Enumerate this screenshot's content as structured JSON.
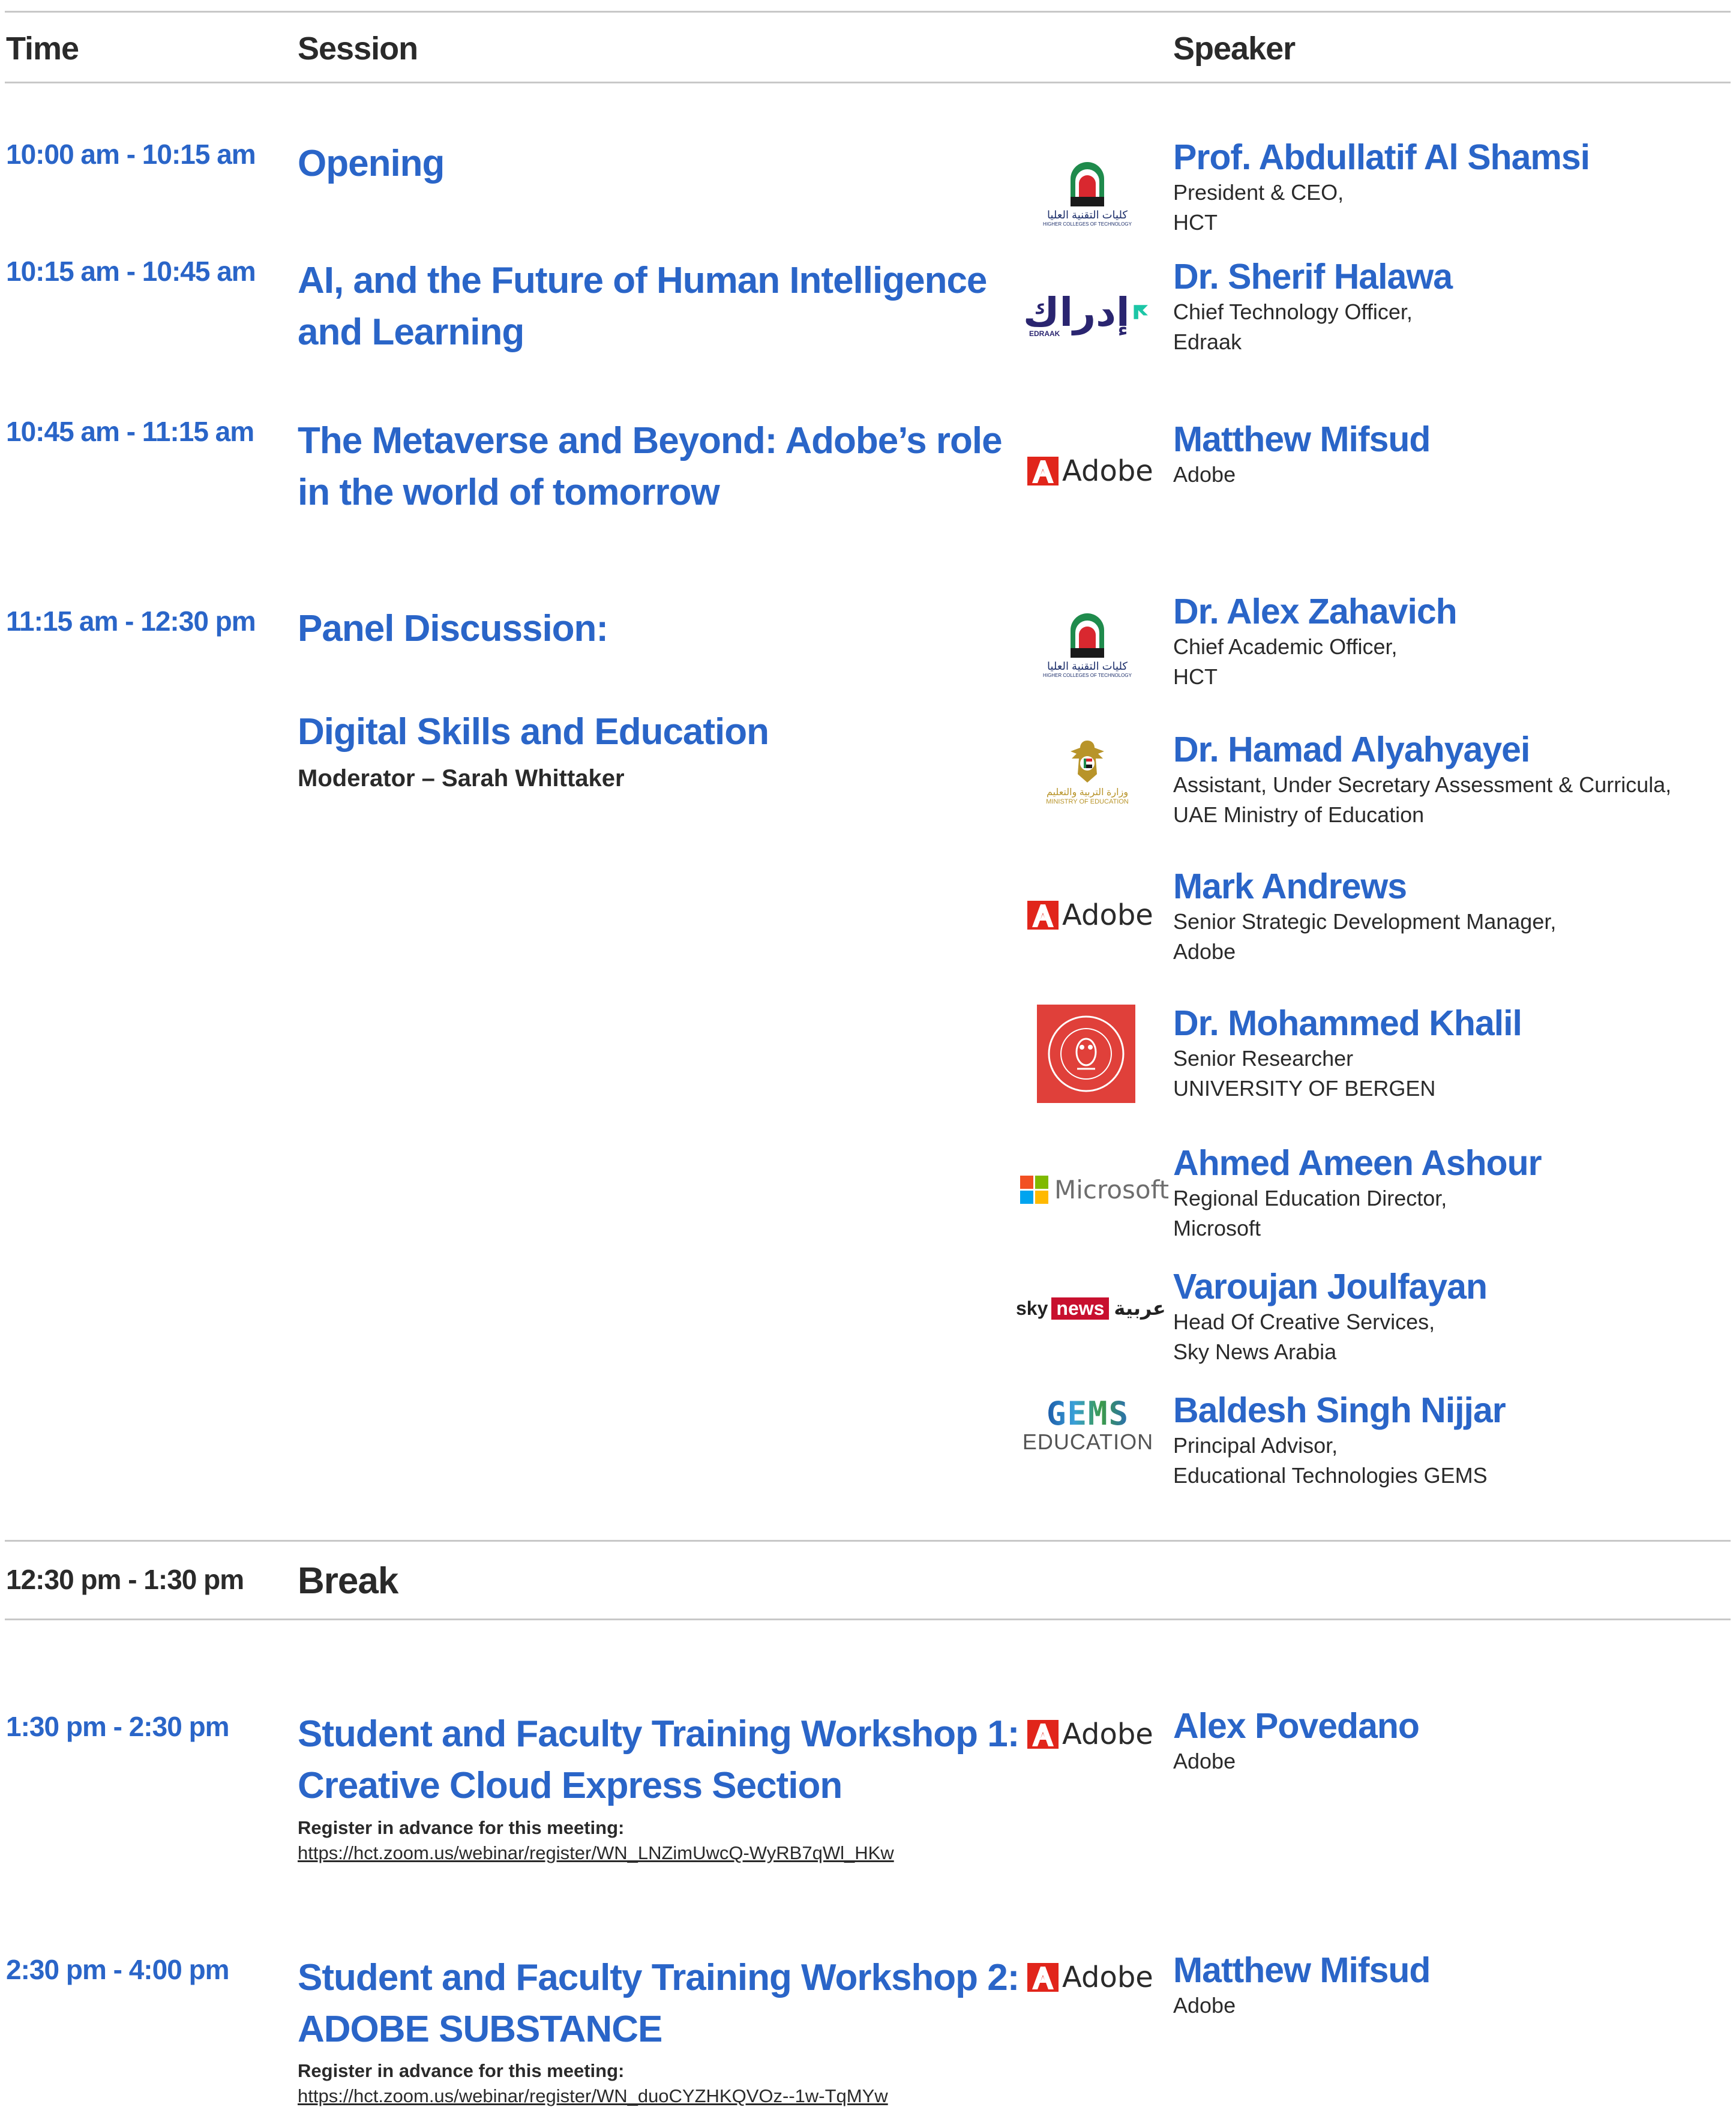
{
  "header": {
    "time": "Time",
    "session": "Session",
    "speaker": "Speaker"
  },
  "rows": [
    {
      "time": "10:00 am - 10:15 am",
      "title": "Opening"
    },
    {
      "time": "10:15 am - 10:45 am",
      "title_lines": [
        "AI, and the Future of Human Intelligence",
        "and Learning"
      ]
    },
    {
      "time": "10:45 am - 11:15 am",
      "title_lines": [
        "The Metaverse and Beyond: Adobe’s role",
        "in the world of tomorrow"
      ]
    },
    {
      "time": "11:15 am - 12:30 pm",
      "title": "Panel Discussion:",
      "subtitle": "Digital Skills and Education",
      "moderator": "Moderator – Sarah Whittaker"
    },
    {
      "time": "12:30 pm - 1:30 pm",
      "title": "Break"
    },
    {
      "time": "1:30 pm - 2:30 pm",
      "title_lines": [
        "Student and Faculty Training Workshop 1:",
        "Creative Cloud Express Section"
      ],
      "register_label": "Register in advance for this meeting:",
      "register_link": "https://hct.zoom.us/webinar/register/WN_LNZimUwcQ-WyRB7qWl_HKw"
    },
    {
      "time": "2:30 pm - 4:00 pm",
      "title_lines": [
        "Student and Faculty Training Workshop 2:",
        "ADOBE SUBSTANCE"
      ],
      "register_label": "Register in advance for this meeting:",
      "register_link": "https://hct.zoom.us/webinar/register/WN_duoCYZHKQVOz--1w-TqMYw"
    }
  ],
  "speakers": [
    {
      "name": "Prof. Abdullatif Al Shamsi",
      "role": [
        "President & CEO,",
        "HCT"
      ],
      "logo": "hct-logo"
    },
    {
      "name": "Dr. Sherif Halawa",
      "role": [
        "Chief Technology Officer,",
        "Edraak"
      ],
      "logo": "edraak-logo"
    },
    {
      "name": "Matthew Mifsud",
      "role": [
        "Adobe"
      ],
      "logo": "adobe-logo"
    },
    {
      "name": "Dr. Alex Zahavich",
      "role": [
        "Chief Academic Officer,",
        "HCT"
      ],
      "logo": "hct-logo"
    },
    {
      "name": "Dr. Hamad Alyahyayei",
      "role": [
        "Assistant, Under Secretary Assessment & Curricula,",
        "UAE Ministry of Education"
      ],
      "logo": "moe-logo"
    },
    {
      "name": "Mark Andrews",
      "role": [
        "Senior Strategic Development Manager,",
        "Adobe"
      ],
      "logo": "adobe-logo"
    },
    {
      "name": "Dr. Mohammed Khalil",
      "role": [
        "Senior Researcher",
        "UNIVERSITY OF BERGEN"
      ],
      "logo": "bergen-logo"
    },
    {
      "name": "Ahmed Ameen Ashour",
      "role": [
        "Regional Education Director,",
        "Microsoft"
      ],
      "logo": "microsoft-logo"
    },
    {
      "name": "Varoujan Joulfayan",
      "role": [
        "Head Of Creative Services,",
        "Sky News Arabia"
      ],
      "logo": "skynews-logo"
    },
    {
      "name": "Baldesh Singh Nijjar",
      "role": [
        "Principal Advisor,",
        "Educational Technologies GEMS"
      ],
      "logo": "gems-logo"
    },
    {
      "name": "Alex Povedano",
      "role": [
        "Adobe"
      ],
      "logo": "adobe-logo"
    },
    {
      "name": "Matthew Mifsud",
      "role": [
        "Adobe"
      ],
      "logo": "adobe-logo"
    }
  ],
  "logos": {
    "hct": {
      "text_ar": "كليات التقنية العليا",
      "text_en": "HIGHER COLLEGES OF TECHNOLOGY"
    },
    "adobe": {
      "word": "Adobe"
    },
    "edraak": {
      "text_ar": "إدراك",
      "text_en": "EDRAAK"
    },
    "moe": {
      "text_ar": "وزارة التربية والتعليم",
      "text_en": "MINISTRY OF EDUCATION"
    },
    "microsoft": {
      "word": "Microsoft"
    },
    "skynews": {
      "sky": "sky",
      "news": "news",
      "ar": "عربية"
    },
    "gems": {
      "word": "GEMS",
      "sub": "EDUCATION"
    }
  },
  "colors": {
    "accent": "#2a65c8",
    "text": "#2a2a2a",
    "rule": "#c8c8c8",
    "adobe_red": "#e1251b",
    "sky_red": "#c8102e",
    "bergen_red": "#e0403a"
  }
}
